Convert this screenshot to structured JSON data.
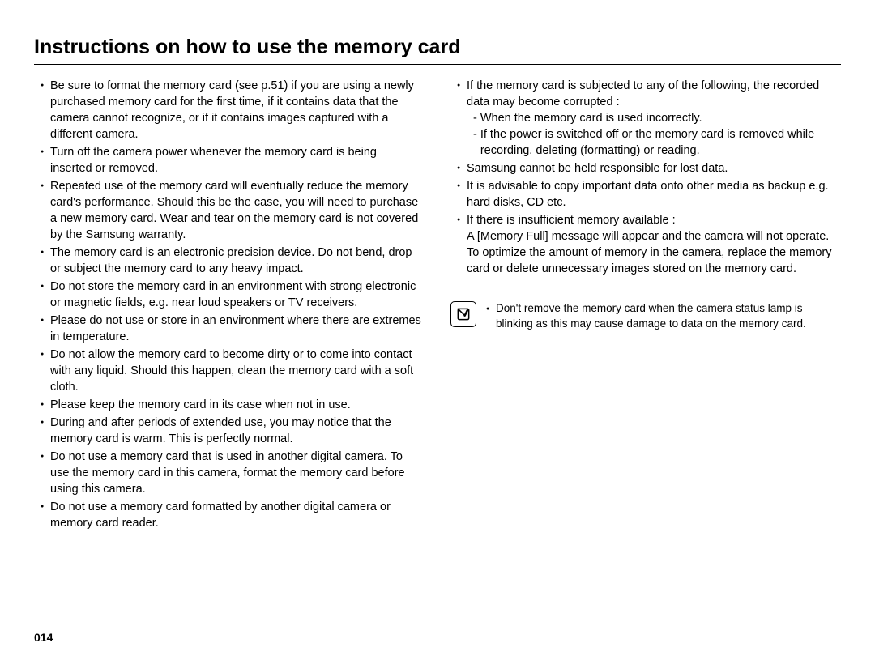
{
  "title": "Instructions on how to use the memory card",
  "page_number": "014",
  "left_bullets": [
    "Be sure to format the memory card (see p.51) if you are using a newly purchased memory card for the first time, if it contains data that the camera cannot recognize, or if it contains images captured with a different camera.",
    "Turn off the camera power whenever the memory card is being inserted or removed.",
    "Repeated use of the memory card will eventually reduce the memory card's performance. Should this be the case, you will need to purchase a new memory card. Wear and tear on the memory card is not covered by the Samsung warranty.",
    "The memory card is an electronic precision device. Do not bend, drop or subject the memory card to any heavy impact.",
    "Do not store the memory card in an environment with strong electronic or magnetic fields, e.g. near loud speakers or TV receivers.",
    "Please do not use or store in an environment where there are extremes in temperature.",
    "Do not allow the memory card to become dirty or to come into contact with any liquid. Should this happen, clean the memory card with a soft cloth.",
    "Please keep the memory card in its case when not in use.",
    "During and after periods of extended use, you may notice that the memory card is warm. This is perfectly normal.",
    "Do not use a memory card that is used in another digital camera. To use the memory card in this camera, format the memory card before using this camera.",
    "Do not use a memory card formatted by another digital camera or memory card reader."
  ],
  "right_bullets": [
    {
      "text": "If the memory card is subjected to any of the following, the recorded data may become corrupted :",
      "sub": [
        "When the memory card is used incorrectly.",
        "If the power is switched off or the memory card is removed while recording, deleting (formatting) or reading."
      ]
    },
    {
      "text": "Samsung cannot be held responsible for lost data."
    },
    {
      "text": "It is advisable to copy important data onto other media as backup e.g. hard disks, CD etc."
    },
    {
      "text": "If there is insufficient memory available :",
      "cont": "A [Memory Full] message will appear and the camera will not operate. To optimize the amount of memory in the camera, replace the memory card or delete unnecessary images stored on the memory card."
    }
  ],
  "note_bullet": "Don't remove the memory card when the camera status lamp is blinking as this may cause damage to data on the memory card."
}
